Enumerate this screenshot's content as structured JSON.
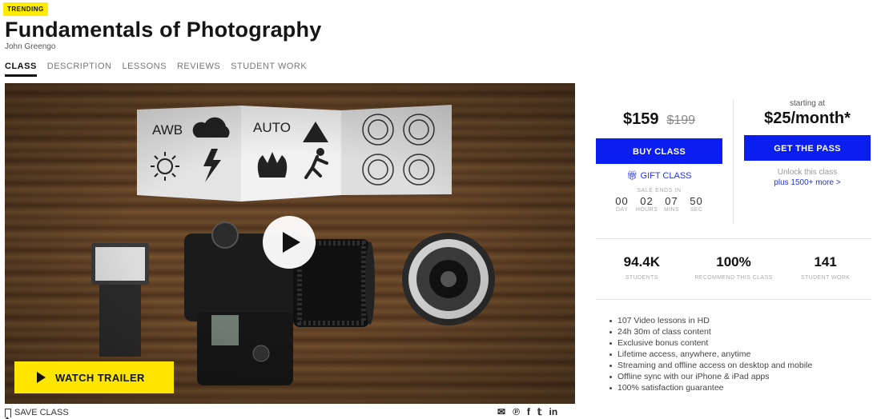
{
  "header": {
    "badge": "TRENDING",
    "title": "Fundamentals of Photography",
    "author": "John Greengo"
  },
  "tabs": [
    {
      "label": "CLASS",
      "active": true
    },
    {
      "label": "DESCRIPTION",
      "active": false
    },
    {
      "label": "LESSONS",
      "active": false
    },
    {
      "label": "REVIEWS",
      "active": false
    },
    {
      "label": "STUDENT WORK",
      "active": false
    }
  ],
  "video": {
    "card_labels": [
      "AWB",
      "AUTO"
    ],
    "watch_trailer": "WATCH TRAILER"
  },
  "below_video": {
    "save_label": "SAVE CLASS",
    "share_icons": [
      "mail-icon",
      "pinterest-icon",
      "facebook-icon",
      "twitter-icon",
      "linkedin-icon"
    ],
    "share_glyphs": [
      "✉",
      "℗",
      "f",
      "𝕥",
      "in"
    ]
  },
  "purchase": {
    "price": "$159",
    "old_price": "$199",
    "buy_label": "BUY CLASS",
    "gift_label": "GIFT CLASS",
    "sale_label": "SALE ENDS IN",
    "timer": [
      {
        "value": "00",
        "unit": "DAY"
      },
      {
        "value": "02",
        "unit": "HOURS"
      },
      {
        "value": "07",
        "unit": "MINS"
      },
      {
        "value": "50",
        "unit": "SEC"
      }
    ]
  },
  "pass": {
    "starting_at": "starting at",
    "price": "$25/month*",
    "button_label": "GET THE PASS",
    "unlock_text": "Unlock this class",
    "more_link": "plus 1500+ more >"
  },
  "stats": [
    {
      "value": "94.4K",
      "label": "STUDENTS"
    },
    {
      "value": "100%",
      "label": "RECOMMEND THIS CLASS"
    },
    {
      "value": "141",
      "label": "STUDENT WORK"
    }
  ],
  "features": [
    "107 Video lessons in HD",
    "24h 30m of class content",
    "Exclusive bonus content",
    "Lifetime access, anywhere, anytime",
    "Streaming and offline access on desktop and mobile",
    "Offline sync with our iPhone & iPad apps",
    "100% satisfaction guarantee"
  ],
  "colors": {
    "accent_blue": "#0a1ef0",
    "badge_yellow": "#ffec00",
    "trailer_yellow": "#ffe600"
  }
}
